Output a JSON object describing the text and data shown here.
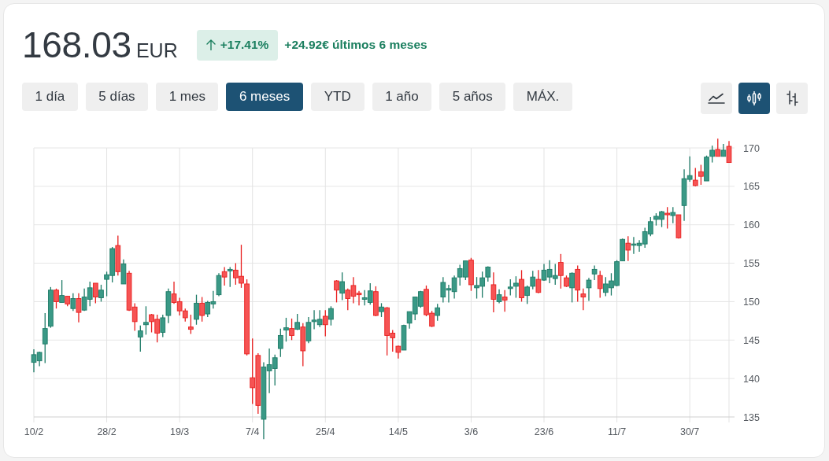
{
  "quote": {
    "price": "168.03",
    "currency": "EUR"
  },
  "change": {
    "percent": "+17.41%",
    "summary": "+24.92€ últimos 6 meses"
  },
  "range_tabs": [
    {
      "label": "1 día",
      "selected": false
    },
    {
      "label": "5 días",
      "selected": false
    },
    {
      "label": "1 mes",
      "selected": false
    },
    {
      "label": "6 meses",
      "selected": true
    },
    {
      "label": "YTD",
      "selected": false
    },
    {
      "label": "1 año",
      "selected": false
    },
    {
      "label": "5 años",
      "selected": false
    },
    {
      "label": "MÁX.",
      "selected": false
    }
  ],
  "chart_types": [
    {
      "kind": "line",
      "selected": false
    },
    {
      "kind": "candlestick",
      "selected": true
    },
    {
      "kind": "ohlc",
      "selected": false
    }
  ],
  "chart": {
    "chart_data": {
      "type": "candlestick",
      "categories": [
        "10/2",
        null,
        null,
        null,
        null,
        null,
        null,
        null,
        null,
        null,
        null,
        null,
        null,
        "28/2",
        null,
        null,
        null,
        null,
        null,
        null,
        null,
        null,
        null,
        null,
        null,
        null,
        "19/3",
        null,
        null,
        null,
        null,
        null,
        null,
        null,
        null,
        null,
        null,
        null,
        null,
        "7/4",
        null,
        null,
        null,
        null,
        null,
        null,
        null,
        null,
        null,
        null,
        null,
        null,
        "25/4",
        null,
        null,
        null,
        null,
        null,
        null,
        null,
        null,
        null,
        null,
        null,
        null,
        "14/5",
        null,
        null,
        null,
        null,
        null,
        null,
        null,
        null,
        null,
        null,
        null,
        null,
        "3/6",
        null,
        null,
        null,
        null,
        null,
        null,
        null,
        null,
        null,
        null,
        null,
        null,
        "23/6",
        null,
        null,
        null,
        null,
        null,
        null,
        null,
        null,
        null,
        null,
        null,
        null,
        "11/7",
        null,
        null,
        null,
        null,
        null,
        null,
        null,
        null,
        null,
        null,
        null,
        null,
        "30/7",
        null,
        null,
        null,
        null,
        null,
        null,
        null
      ],
      "ohlc": [
        [
          142.1,
          143.8,
          140.8,
          143.1
        ],
        [
          142.3,
          143.5,
          141.6,
          143.4
        ],
        [
          144.5,
          148.5,
          142.0,
          146.5
        ],
        [
          146.8,
          151.9,
          146.6,
          151.5
        ],
        [
          151.5,
          151.7,
          149.1,
          150.0
        ],
        [
          149.9,
          152.8,
          149.9,
          150.8
        ],
        [
          150.7,
          150.7,
          149.4,
          149.7
        ],
        [
          149.1,
          151.1,
          148.8,
          150.4
        ],
        [
          150.4,
          151.1,
          147.3,
          148.6
        ],
        [
          148.9,
          151.7,
          148.8,
          150.6
        ],
        [
          150.3,
          152.6,
          149.4,
          151.8
        ],
        [
          152.4,
          152.4,
          149.8,
          150.6
        ],
        [
          150.5,
          152.2,
          150.0,
          151.5
        ],
        [
          152.9,
          153.9,
          150.7,
          153.5
        ],
        [
          153.4,
          157.1,
          152.5,
          156.9
        ],
        [
          157.3,
          158.6,
          153.4,
          153.9
        ],
        [
          152.3,
          155.5,
          152.3,
          154.9
        ],
        [
          153.7,
          154.0,
          148.8,
          148.9
        ],
        [
          149.3,
          149.8,
          146.2,
          147.4
        ],
        [
          145.4,
          146.9,
          143.5,
          146.2
        ],
        [
          147.0,
          149.4,
          145.7,
          147.3
        ],
        [
          148.3,
          148.4,
          146.0,
          147.4
        ],
        [
          147.7,
          148.3,
          144.7,
          145.9
        ],
        [
          146.0,
          148.3,
          145.4,
          147.9
        ],
        [
          148.2,
          151.7,
          147.2,
          151.3
        ],
        [
          151.0,
          152.6,
          149.7,
          149.9
        ],
        [
          150.0,
          150.5,
          148.2,
          148.8
        ],
        [
          148.8,
          149.1,
          147.4,
          147.9
        ],
        [
          146.7,
          148.3,
          145.8,
          146.4
        ],
        [
          147.7,
          150.9,
          147.0,
          149.8
        ],
        [
          149.8,
          150.6,
          147.4,
          148.2
        ],
        [
          148.4,
          150.1,
          148.0,
          149.9
        ],
        [
          149.7,
          151.4,
          149.1,
          150.0
        ],
        [
          150.9,
          153.7,
          150.7,
          153.4
        ],
        [
          153.9,
          154.5,
          152.1,
          153.2
        ],
        [
          154.0,
          154.5,
          151.9,
          154.2
        ],
        [
          154.1,
          155.0,
          152.2,
          153.1
        ],
        [
          153.3,
          157.4,
          151.8,
          152.4
        ],
        [
          152.3,
          152.9,
          143.0,
          143.2
        ],
        [
          140.1,
          145.2,
          136.7,
          138.8
        ],
        [
          143.0,
          143.3,
          135.4,
          136.5
        ],
        [
          134.7,
          142.1,
          132.1,
          141.5
        ],
        [
          141.0,
          143.9,
          138.1,
          141.8
        ],
        [
          141.3,
          143.1,
          139.1,
          142.7
        ],
        [
          143.9,
          146.5,
          142.8,
          145.6
        ],
        [
          146.3,
          147.9,
          144.8,
          146.6
        ],
        [
          146.5,
          147.8,
          145.0,
          145.6
        ],
        [
          146.4,
          148.4,
          146.3,
          147.3
        ],
        [
          146.7,
          147.2,
          141.6,
          143.6
        ],
        [
          144.9,
          148.0,
          144.6,
          147.3
        ],
        [
          147.4,
          148.9,
          146.4,
          147.6
        ],
        [
          147.0,
          148.9,
          146.7,
          147.7
        ],
        [
          148.1,
          148.9,
          145.5,
          147.0
        ],
        [
          147.7,
          149.4,
          146.9,
          149.1
        ],
        [
          152.7,
          152.8,
          149.9,
          151.5
        ],
        [
          151.1,
          153.8,
          150.2,
          152.6
        ],
        [
          151.5,
          151.7,
          148.9,
          150.4
        ],
        [
          152.1,
          153.2,
          149.8,
          150.7
        ],
        [
          151.1,
          151.4,
          149.5,
          150.9
        ],
        [
          150.3,
          151.5,
          149.5,
          150.5
        ],
        [
          149.9,
          152.4,
          149.6,
          151.4
        ],
        [
          151.3,
          152.0,
          148.1,
          148.2
        ],
        [
          148.7,
          149.8,
          148.0,
          149.3
        ],
        [
          149.2,
          149.3,
          143.0,
          145.6
        ],
        [
          145.9,
          146.3,
          143.5,
          145.3
        ],
        [
          144.2,
          144.3,
          142.6,
          143.4
        ],
        [
          143.7,
          147.0,
          143.7,
          146.9
        ],
        [
          147.2,
          148.7,
          146.5,
          148.7
        ],
        [
          148.4,
          150.6,
          147.6,
          150.6
        ],
        [
          149.4,
          151.4,
          149.2,
          151.3
        ],
        [
          151.6,
          152.1,
          148.1,
          148.3
        ],
        [
          148.5,
          148.8,
          146.7,
          146.8
        ],
        [
          148.2,
          149.7,
          147.5,
          149.2
        ],
        [
          150.6,
          153.2,
          149.9,
          152.5
        ],
        [
          151.5,
          152.2,
          149.9,
          151.7
        ],
        [
          151.3,
          153.4,
          150.4,
          153.1
        ],
        [
          153.2,
          154.8,
          152.1,
          154.3
        ],
        [
          153.2,
          155.3,
          152.8,
          155.3
        ],
        [
          155.4,
          155.7,
          151.4,
          152.2
        ],
        [
          151.8,
          153.2,
          150.4,
          152.1
        ],
        [
          152.0,
          153.9,
          150.5,
          153.1
        ],
        [
          153.2,
          154.6,
          152.6,
          154.5
        ],
        [
          152.2,
          153.8,
          148.6,
          150.3
        ],
        [
          150.0,
          151.6,
          149.8,
          150.9
        ],
        [
          150.6,
          151.5,
          148.7,
          150.2
        ],
        [
          151.7,
          152.9,
          150.8,
          151.9
        ],
        [
          152.0,
          153.3,
          150.5,
          152.4
        ],
        [
          152.9,
          154.1,
          150.0,
          150.5
        ],
        [
          150.8,
          152.1,
          149.7,
          151.9
        ],
        [
          152.0,
          154.0,
          151.6,
          153.2
        ],
        [
          152.9,
          154.1,
          151.1,
          151.2
        ],
        [
          152.8,
          154.9,
          152.7,
          154.1
        ],
        [
          153.2,
          155.4,
          152.4,
          154.2
        ],
        [
          153.0,
          154.9,
          152.2,
          153.4
        ],
        [
          155.1,
          156.2,
          151.7,
          153.4
        ],
        [
          153.1,
          153.4,
          151.9,
          152.0
        ],
        [
          151.8,
          153.8,
          149.9,
          153.7
        ],
        [
          154.2,
          154.7,
          150.0,
          151.5
        ],
        [
          151.0,
          151.7,
          148.9,
          150.6
        ],
        [
          151.8,
          153.1,
          150.1,
          152.8
        ],
        [
          153.6,
          154.7,
          152.8,
          154.2
        ],
        [
          153.4,
          154.0,
          150.5,
          151.7
        ],
        [
          151.2,
          153.2,
          150.7,
          152.3
        ],
        [
          151.8,
          153.7,
          150.8,
          152.7
        ],
        [
          152.1,
          155.4,
          152.0,
          155.2
        ],
        [
          155.3,
          158.2,
          155.3,
          158.1
        ],
        [
          157.6,
          158.5,
          155.3,
          156.7
        ],
        [
          157.4,
          158.4,
          156.2,
          157.5
        ],
        [
          157.3,
          158.0,
          156.5,
          157.6
        ],
        [
          157.5,
          159.6,
          157.0,
          159.1
        ],
        [
          158.8,
          161.0,
          158.5,
          160.4
        ],
        [
          160.7,
          161.5,
          159.9,
          161.1
        ],
        [
          160.7,
          161.8,
          159.7,
          161.7
        ],
        [
          161.5,
          162.3,
          159.5,
          161.3
        ],
        [
          161.2,
          162.3,
          160.2,
          161.6
        ],
        [
          161.3,
          161.3,
          158.2,
          158.3
        ],
        [
          162.5,
          167.2,
          160.5,
          166.0
        ],
        [
          165.9,
          168.9,
          165.6,
          166.4
        ],
        [
          165.8,
          167.4,
          165.0,
          165.1
        ],
        [
          166.9,
          167.8,
          165.2,
          166.3
        ],
        [
          165.7,
          169.0,
          165.7,
          168.8
        ],
        [
          168.9,
          170.3,
          168.1,
          169.7
        ],
        [
          169.8,
          171.2,
          168.9,
          168.9
        ],
        [
          168.9,
          170.5,
          168.9,
          169.7
        ],
        [
          170.2,
          170.9,
          168.1,
          168.1
        ]
      ],
      "ylim": [
        135,
        170
      ],
      "yticks": [
        170,
        165,
        160,
        155,
        150,
        145,
        140,
        135
      ],
      "grid": true
    }
  }
}
